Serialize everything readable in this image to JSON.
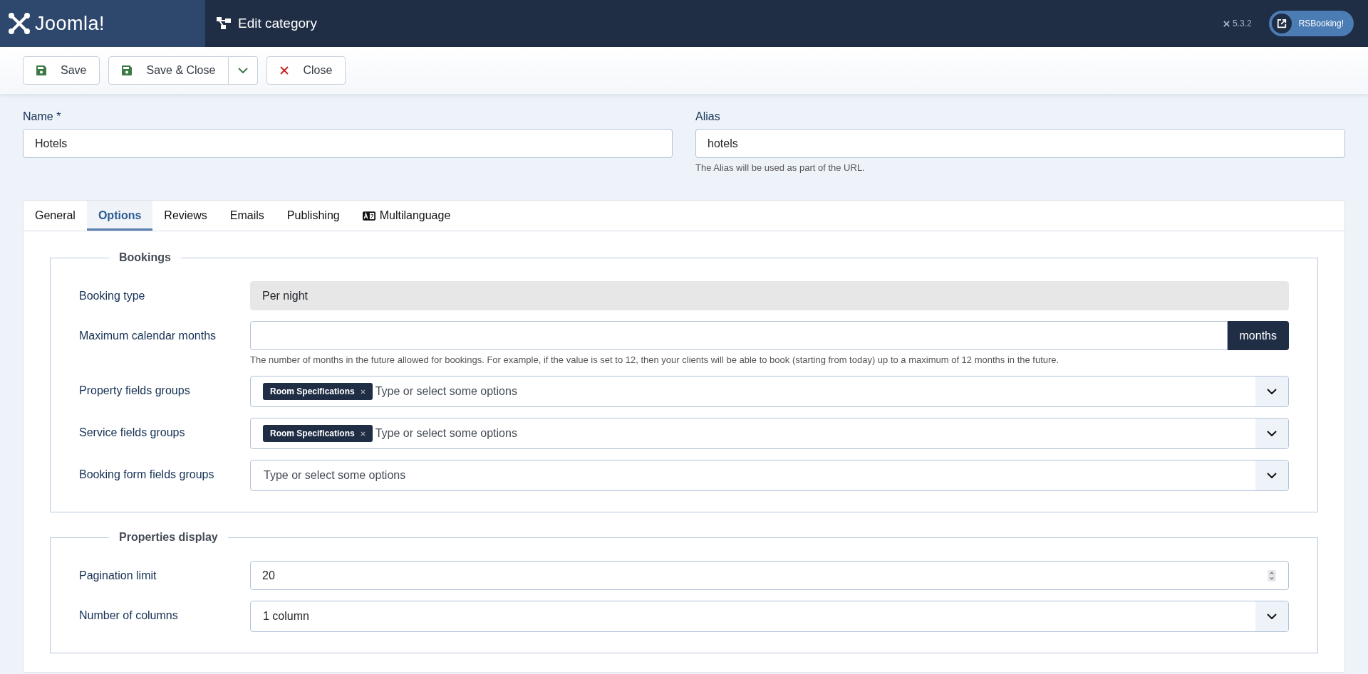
{
  "header": {
    "brand": "Joomla!",
    "title": "Edit category",
    "version": "5.3.2",
    "site_button": "RSBooking!"
  },
  "toolbar": [
    {
      "kind": "save",
      "label": "Save"
    },
    {
      "kind": "save-split",
      "label": "Save & Close"
    },
    {
      "kind": "close",
      "label": "Close"
    }
  ],
  "name_field": {
    "label": "Name *",
    "value": "Hotels"
  },
  "alias_field": {
    "label": "Alias",
    "value": "hotels",
    "hint": "The Alias will be used as part of the URL."
  },
  "tabs": [
    {
      "label": "General",
      "selected": false
    },
    {
      "label": "Options",
      "selected": true
    },
    {
      "label": "Reviews",
      "selected": false
    },
    {
      "label": "Emails",
      "selected": false
    },
    {
      "label": "Publishing",
      "selected": false
    },
    {
      "label": "Multilanguage",
      "selected": false,
      "has_icon": true
    }
  ],
  "fieldsets": [
    {
      "legend": "Bookings",
      "fields": [
        {
          "kind": "readonly",
          "label": "Booking type",
          "value": "Per night"
        },
        {
          "kind": "addon",
          "label": "Maximum calendar months",
          "addon": "months",
          "hint": "The number of months in the future allowed for bookings. For example, if the value is set to 12, then your clients will be able to book (starting from today) up to a maximum of 12 months in the future."
        },
        {
          "kind": "multiselect",
          "label": "Property fields groups",
          "tags": [
            "Room Specifications"
          ],
          "placeholder": "Type or select some options"
        },
        {
          "kind": "multiselect",
          "label": "Service fields groups",
          "tags": [
            "Room Specifications"
          ],
          "placeholder": "Type or select some options"
        },
        {
          "kind": "multiselect",
          "label": "Booking form fields groups",
          "placeholder": "Type or select some options"
        }
      ]
    },
    {
      "legend": "Properties display",
      "fields": [
        {
          "kind": "number",
          "label": "Pagination limit",
          "value": "20"
        },
        {
          "kind": "select",
          "label": "Number of columns",
          "value": "1 column"
        }
      ]
    }
  ]
}
